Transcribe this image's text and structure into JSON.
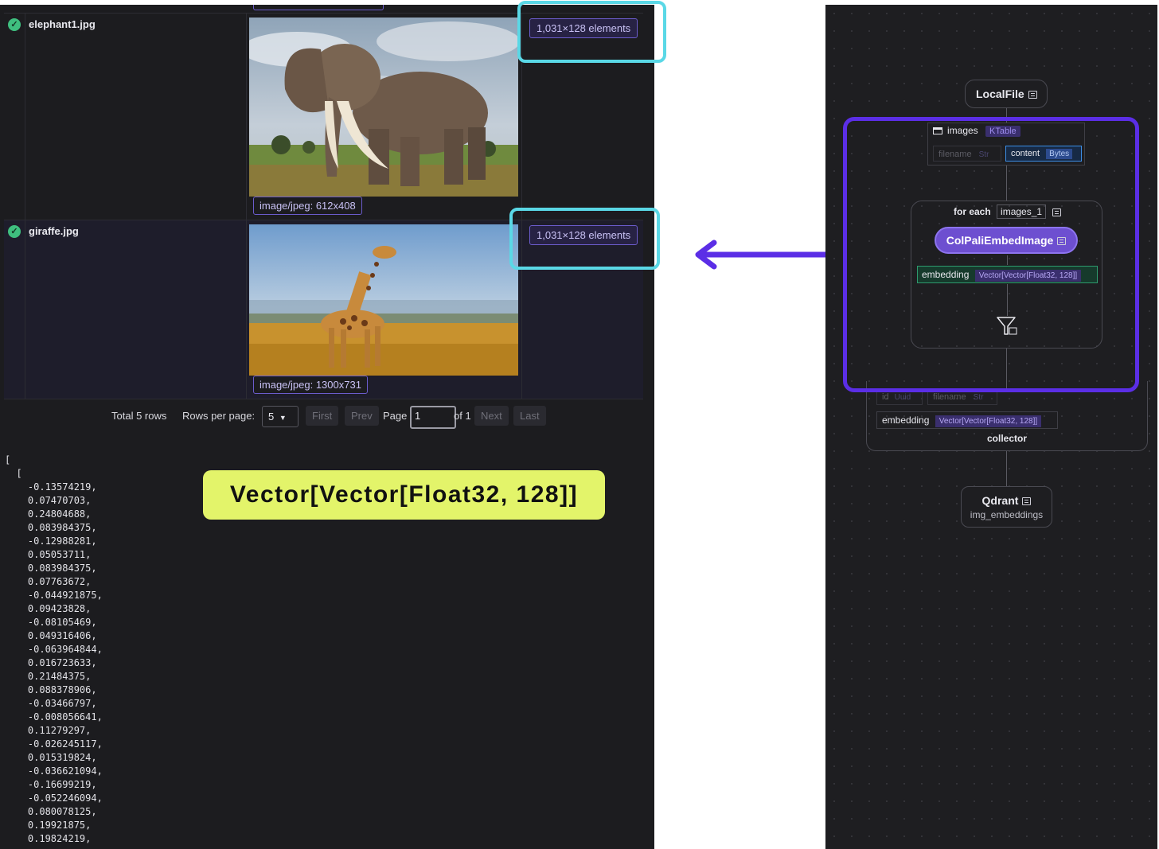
{
  "table": {
    "rows": [
      {
        "filename": "elephant1.jpg",
        "mime": "image/jpeg: 612x408",
        "embedding": "1,031×128 elements"
      },
      {
        "filename": "giraffe.jpg",
        "mime": "image/jpeg: 1300x731",
        "embedding": "1,031×128 elements"
      }
    ]
  },
  "pagination": {
    "total": "Total 5 rows",
    "rows_per_page_label": "Rows per page:",
    "rows_per_page_value": "5",
    "first": "First",
    "prev": "Prev",
    "page_label": "Page",
    "page_value": "1",
    "of_label": "of 1",
    "next": "Next",
    "last": "Last"
  },
  "vector_dump": "[\n  [\n    -0.13574219,\n    0.07470703,\n    0.24804688,\n    0.083984375,\n    -0.12988281,\n    0.05053711,\n    0.083984375,\n    0.07763672,\n    -0.044921875,\n    0.09423828,\n    -0.08105469,\n    0.049316406,\n    -0.063964844,\n    0.016723633,\n    0.21484375,\n    0.088378906,\n    -0.03466797,\n    -0.008056641,\n    0.11279297,\n    -0.026245117,\n    0.015319824,\n    -0.036621094,\n    -0.16699219,\n    -0.052246094,\n    0.080078125,\n    0.19921875,\n    0.19824219,",
  "type_badge": "Vector[Vector[Float32, 128]]",
  "flow": {
    "source": {
      "name": "LocalFile"
    },
    "images": {
      "name": "images",
      "type": "KTable",
      "fields": [
        {
          "name": "filename",
          "type": "Str"
        },
        {
          "name": "content",
          "type": "Bytes"
        }
      ]
    },
    "foreach": {
      "label": "for each",
      "item": "images_1"
    },
    "transform": {
      "name": "ColPaliEmbedImage",
      "output_name": "embedding",
      "output_type": "Vector[Vector[Float32, 128]]"
    },
    "collector": {
      "label": "collector",
      "fields": [
        {
          "name": "id",
          "type": "Uuid"
        },
        {
          "name": "filename",
          "type": "Str"
        },
        {
          "name": "embedding",
          "type": "Vector[Vector[Float32, 128]]"
        }
      ]
    },
    "target": {
      "name": "Qdrant",
      "sub": "img_embeddings"
    }
  },
  "colors": {
    "highlight_cyan": "#5ad8e6",
    "highlight_purple": "#5b2ee6",
    "badge": "#e3f46a",
    "success": "#3fbf7f"
  }
}
